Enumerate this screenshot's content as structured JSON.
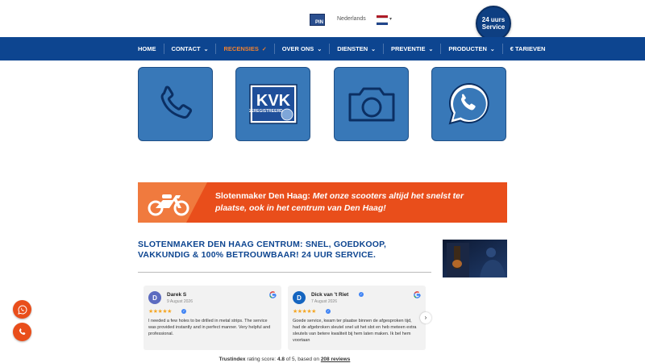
{
  "header": {
    "language": "Nederlands",
    "pin_logo_text": "PIN",
    "service_badge_line1": "24 uurs",
    "service_badge_line2": "Service",
    "flag_colors": [
      "#ae1c28",
      "#ffffff",
      "#21468b"
    ]
  },
  "nav": {
    "items": [
      {
        "label": "HOME",
        "chevron": false,
        "active": false
      },
      {
        "label": "CONTACT",
        "chevron": true,
        "active": false
      },
      {
        "label": "RECENSIES",
        "chevron": true,
        "active": true
      },
      {
        "label": "OVER ONS",
        "chevron": true,
        "active": false
      },
      {
        "label": "DIENSTEN",
        "chevron": true,
        "active": false
      },
      {
        "label": "PREVENTIE",
        "chevron": true,
        "active": false
      },
      {
        "label": "PRODUCTEN",
        "chevron": true,
        "active": false
      },
      {
        "label": "€ TARIEVEN",
        "chevron": false,
        "active": false
      }
    ],
    "bg_color": "#0d4590",
    "active_color": "#f0812f"
  },
  "tiles": [
    {
      "icon": "phone-icon"
    },
    {
      "icon": "kvk-logo",
      "kvk_text": "KVK",
      "kvk_sub": "GEREGISTREERD"
    },
    {
      "icon": "camera-icon"
    },
    {
      "icon": "whatsapp-icon"
    }
  ],
  "banner": {
    "prefix": "Slotenmaker Den Haag:",
    "text": "Met onze scooters altijd het snelst ter plaatse, ook in het centrum van Den Haag!",
    "color": "#e94e1b"
  },
  "section": {
    "heading": "SLOTENMAKER DEN HAAG CENTRUM: SNEL, GOEDKOOP, VAKKUNDIG & 100% BETROUWBAAR! 24 UUR SERVICE."
  },
  "reviews": [
    {
      "initial": "D",
      "name": "Darek S",
      "date": "9 August 2026",
      "stars": 5,
      "avatar_color": "#5c6bc0",
      "text": "I needed a few holes to be drilled in metal strips. The service was provided instantly and in perfect manner. Very helpful and professional."
    },
    {
      "initial": "D",
      "name": "Dick van 't Riet",
      "date": "7 August 2026",
      "stars": 5,
      "avatar_color": "#1565c0",
      "text": "Goede service, kwam ter plaatse binnen de afgesproken tijd, had de afgebroken sleutel snel uit het slot en heb meteen extra sleutels van betere kwaliteit bij hem laten maken. Ik bel hem voortaan"
    }
  ],
  "trustindex": {
    "brand": "Trustindex",
    "label": "rating score:",
    "score": "4.8",
    "of": "of 5, based on",
    "reviews_link": "208 reviews"
  },
  "fabs": [
    {
      "icon": "whatsapp-icon"
    },
    {
      "icon": "phone-icon"
    }
  ]
}
